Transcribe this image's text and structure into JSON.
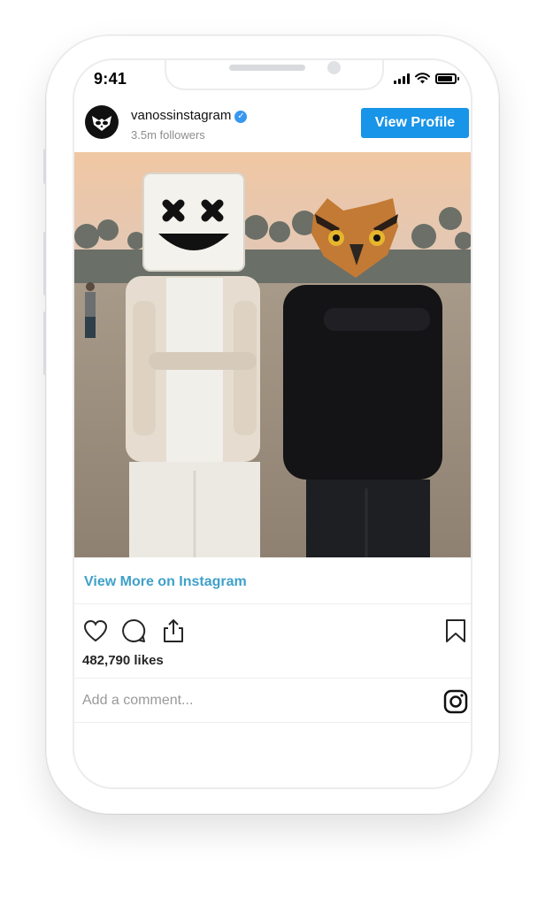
{
  "status_bar": {
    "time": "9:41"
  },
  "post": {
    "username": "vanossinstagram",
    "followers": "3.5m followers",
    "view_profile_label": "View Profile",
    "view_more_label": "View More on Instagram",
    "likes": "482,790 likes",
    "comment_placeholder": "Add a comment..."
  },
  "colors": {
    "button_blue": "#1894e8",
    "link_blue": "#3fa0c9",
    "verified_blue": "#3897f0"
  },
  "icons": [
    "heart-icon",
    "comment-icon",
    "share-icon",
    "bookmark-icon",
    "instagram-icon",
    "verified-icon",
    "signal-icon",
    "wifi-icon",
    "battery-icon"
  ]
}
